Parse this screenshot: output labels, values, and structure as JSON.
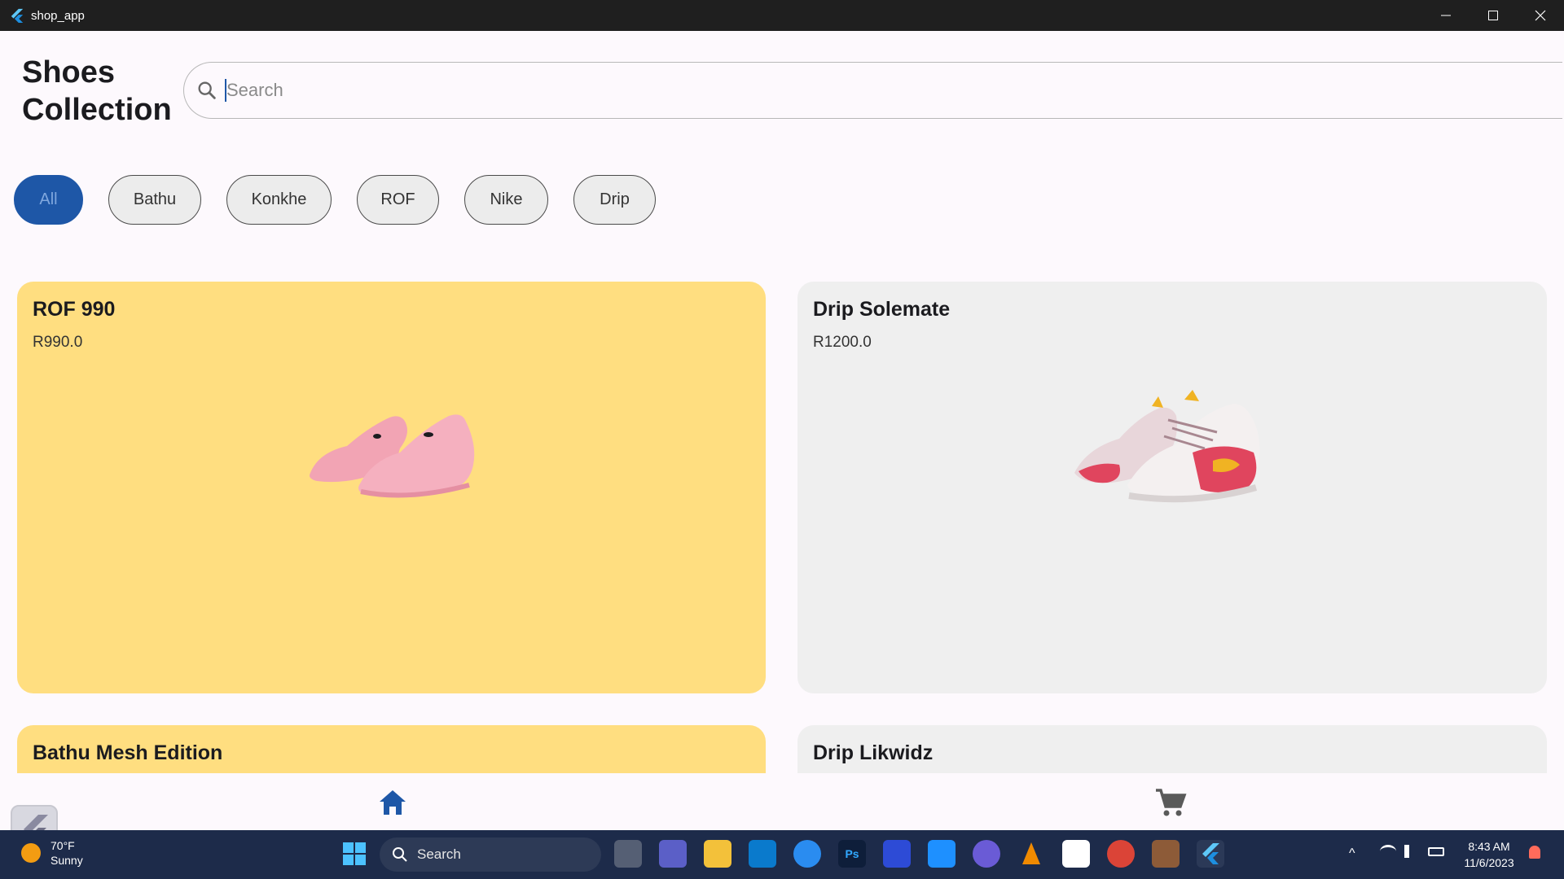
{
  "window": {
    "title": "shop_app"
  },
  "app": {
    "heading_line1": "Shoes",
    "heading_line2": "Collection",
    "search": {
      "placeholder": "Search",
      "value": ""
    },
    "filters": [
      {
        "label": "All",
        "active": true
      },
      {
        "label": "Bathu",
        "active": false
      },
      {
        "label": "Konkhe",
        "active": false
      },
      {
        "label": "ROF",
        "active": false
      },
      {
        "label": "Nike",
        "active": false
      },
      {
        "label": "Drip",
        "active": false
      }
    ],
    "products": [
      {
        "title": "ROF 990",
        "price": "R990.0",
        "background": "#ffde80"
      },
      {
        "title": "Drip Solemate",
        "price": "R1200.0",
        "background": "#efefef"
      },
      {
        "title": "Bathu Mesh Edition",
        "price": "",
        "background": "#ffde80"
      },
      {
        "title": "Drip Likwidz",
        "price": "",
        "background": "#efefef"
      }
    ],
    "bottom_nav": [
      {
        "icon": "home-icon",
        "active": true
      },
      {
        "icon": "cart-icon",
        "active": false
      }
    ]
  },
  "colors": {
    "accent": "#1e57a7",
    "card_yellow": "#ffde80",
    "card_grey": "#efefef"
  },
  "taskbar": {
    "weather": {
      "temp": "70°F",
      "condition": "Sunny"
    },
    "search_label": "Search",
    "clock": {
      "time": "8:43 AM",
      "date": "11/6/2023"
    },
    "apps": [
      "start",
      "task-view",
      "teams",
      "file-explorer",
      "vscode",
      "app-store",
      "photoshop",
      "affinity",
      "edge-alt",
      "copilot",
      "vlc",
      "microsoft-store",
      "chrome",
      "git",
      "flutter"
    ]
  }
}
